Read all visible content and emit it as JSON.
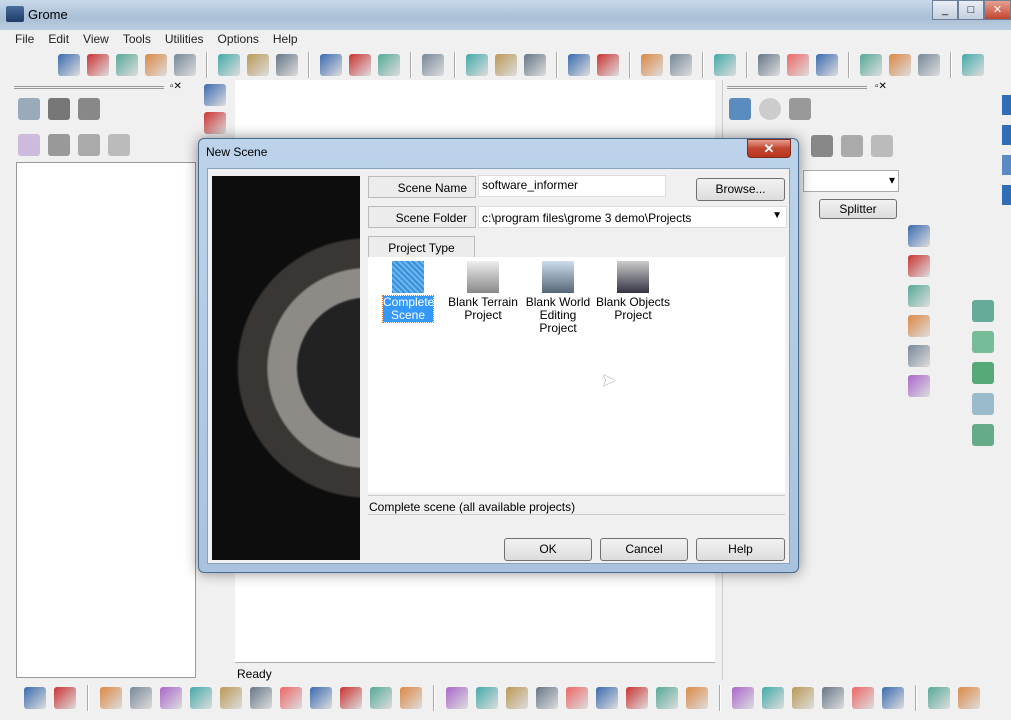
{
  "window": {
    "title": "Grome",
    "controls": [
      "_",
      "□",
      "✕"
    ]
  },
  "menu": [
    "File",
    "Edit",
    "View",
    "Tools",
    "Utilities",
    "Options",
    "Help"
  ],
  "toolbar_icons": [
    "road-spline-icon",
    "delete-spline-icon",
    "split-spline-icon",
    "connect-spline-icon",
    "validate-spline-icon",
    "|",
    "object-place-icon",
    "object-group-icon",
    "object-link-icon",
    "|",
    "move-icon",
    "rotate-icon",
    "scale-icon",
    "|",
    "chain-icon",
    "|",
    "layer-blue-icon",
    "layer-green-icon",
    "layer-orange-icon",
    "|",
    "add-node-icon",
    "remove-node-icon",
    "|",
    "mesh-a-icon",
    "mesh-b-icon",
    "|",
    "save-mesh-icon",
    "|",
    "flag-icon",
    "print-icon",
    "select-icon",
    "|",
    "page-icon",
    "page2-icon",
    "page3-icon",
    "|",
    "zoom-fit-icon"
  ],
  "vertical_tool_icons": [
    "terrain-light-icon",
    "brush-tool-icon"
  ],
  "right_panel": {
    "splitter_label": "Splitter"
  },
  "right_icons": [
    "paint-icon",
    "stack-icon",
    "terrain-warn-icon",
    "gradient-icon",
    "flower-icon",
    "terrain-layers-icon"
  ],
  "status": {
    "text": "Ready"
  },
  "bottom_icons": [
    "layer-orange-icon",
    "layer-green-icon",
    "|",
    "brush-terrain-icon",
    "info-icon",
    "terrain-icon",
    "water-icon",
    "import-icon",
    "rock-icon",
    "flat-icon",
    "erode-icon",
    "tile-icon",
    "red-square-icon",
    "triangle-icon",
    "|",
    "paint-a-icon",
    "paint-b-icon",
    "paint-c-icon",
    "paint-d-icon",
    "paint-e-icon",
    "paint-f-icon",
    "paint-g-icon",
    "paint-h-icon",
    "paint-i-icon",
    "|",
    "mountain-a-icon",
    "mountain-b-icon",
    "mountain-c-icon",
    "mountain-d-icon",
    "mountain-e-icon",
    "mountain-f-icon",
    "|",
    "mask-icon",
    "theatre-icon"
  ],
  "dialog": {
    "title": "New Scene",
    "scene_name_label": "Scene Name",
    "scene_name_value": "software_informer",
    "browse_label": "Browse...",
    "scene_folder_label": "Scene Folder",
    "scene_folder_value": "c:\\program files\\grome 3 demo\\Projects",
    "project_type_label": "Project Type",
    "projects": [
      {
        "label": "Complete Scene",
        "icon": "complete-scene-icon",
        "selected": true
      },
      {
        "label": "Blank Terrain Project",
        "icon": "blank-terrain-icon",
        "selected": false
      },
      {
        "label": "Blank World Editing Project",
        "icon": "world-editing-icon",
        "selected": false
      },
      {
        "label": "Blank Objects Project",
        "icon": "objects-icon",
        "selected": false
      }
    ],
    "description": "Complete scene (all available projects)",
    "ok_label": "OK",
    "cancel_label": "Cancel",
    "help_label": "Help"
  }
}
